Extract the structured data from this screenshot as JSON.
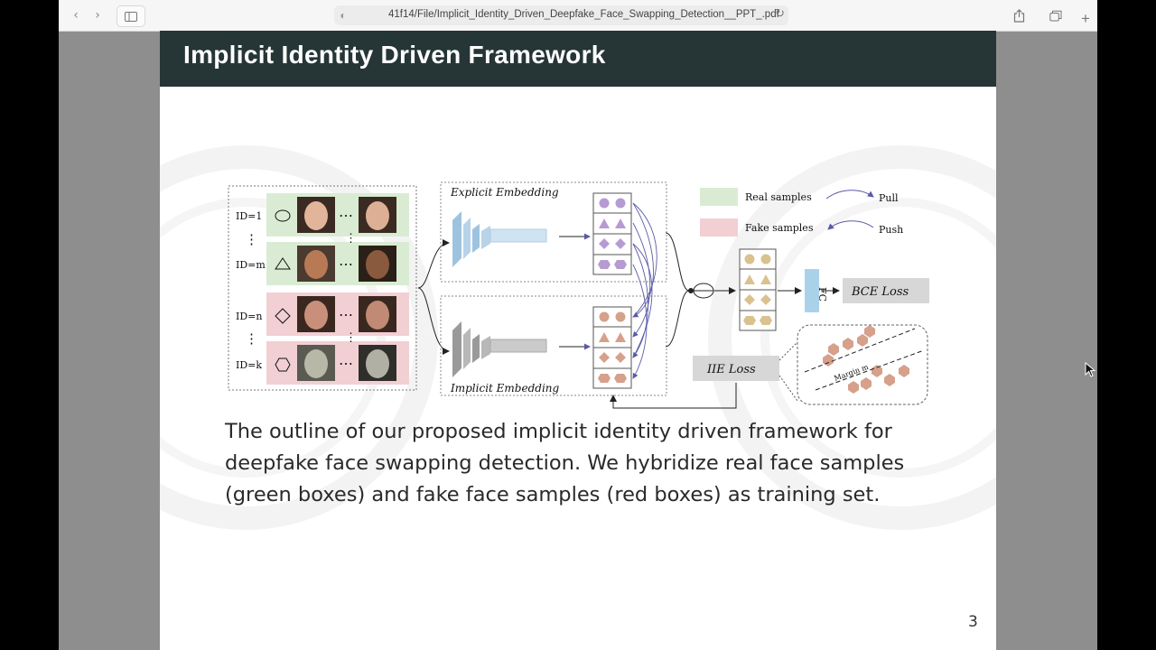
{
  "browser": {
    "url": "41f14/File/Implicit_Identity_Driven_Deepfake_Face_Swapping_Detection__PPT_.pdf",
    "back_icon": "‹",
    "forward_icon": "›",
    "reload_icon": "↻",
    "shield_icon": "◐",
    "new_tab_icon": "+"
  },
  "slide": {
    "title": "Implicit Identity Driven Framework",
    "caption": "The outline of our proposed implicit identity driven framework for deepfake face swapping detection. We hybridize real face samples (green boxes) and fake face samples (red boxes) as training set.",
    "page_number": "3"
  },
  "figure": {
    "id_labels": [
      "ID=1",
      "ID=m",
      "ID=n",
      "ID=k"
    ],
    "ellipsis": "⋯",
    "vdots": "⋮",
    "explicit_label": "Explicit Embedding",
    "implicit_label": "Implicit Embedding",
    "legend_real": "Real samples",
    "legend_fake": "Fake samples",
    "legend_pull": "Pull",
    "legend_push": "Push",
    "fc_label": "FC",
    "bce_loss": "BCE Loss",
    "iie_loss": "IIE Loss",
    "margin_label": "Margin m",
    "colors": {
      "real": "#d9ecd3",
      "fake": "#f2cfd3",
      "purple": "#b69bd2",
      "tan": "#d9c28f",
      "salmon": "#d6a08b",
      "fc": "#a9d2ea",
      "loss": "#d7d7d7",
      "header": "#263535"
    }
  }
}
